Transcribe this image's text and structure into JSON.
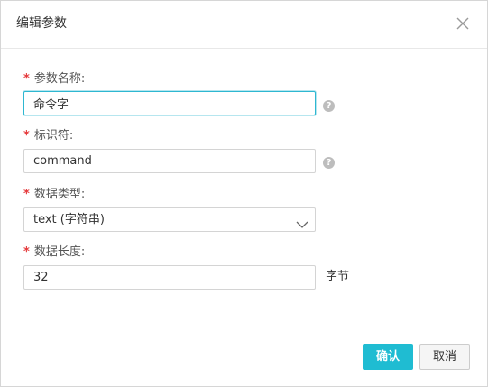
{
  "dialog": {
    "title": "编辑参数",
    "close_icon": "close-icon"
  },
  "form": {
    "required_mark": "*",
    "param_name": {
      "label": "参数名称:",
      "value": "命令字",
      "help_icon": "question-circle-icon"
    },
    "identifier": {
      "label": "标识符:",
      "value": "command",
      "help_icon": "question-circle-icon"
    },
    "data_type": {
      "label": "数据类型:",
      "selected": "text (字符串)",
      "icon": "chevron-down-icon"
    },
    "data_length": {
      "label": "数据长度:",
      "value": "32",
      "unit": "字节"
    },
    "help_glyph": "?"
  },
  "footer": {
    "confirm_label": "确认",
    "cancel_label": "取消"
  },
  "colors": {
    "primary": "#1fbcd2",
    "required": "#e5393b",
    "focus_border": "#2eb7d1"
  }
}
